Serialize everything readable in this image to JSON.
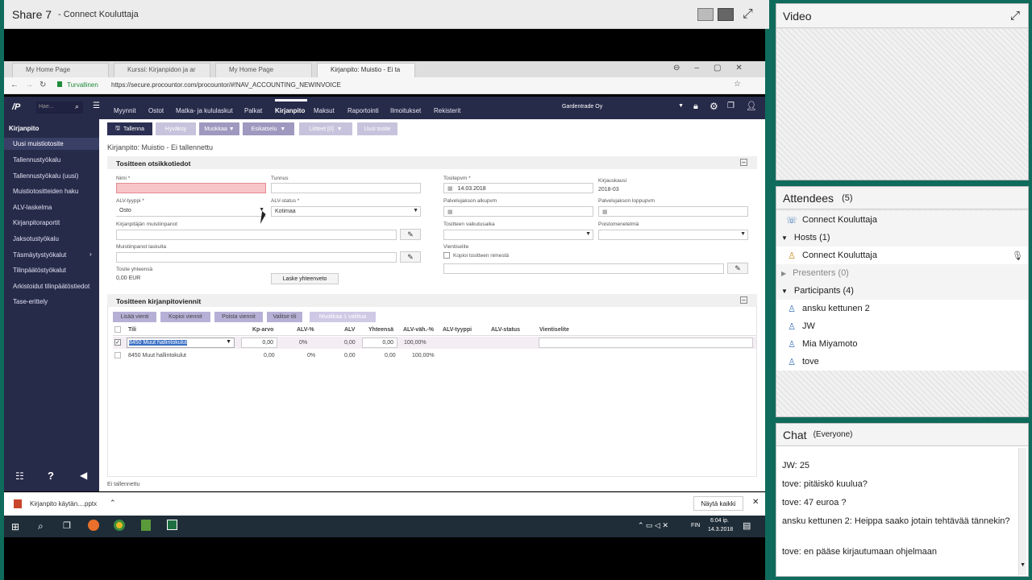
{
  "app": {
    "title": "Share 7",
    "subtitle": "- Connect Kouluttaja"
  },
  "browser": {
    "tabs": [
      "My Home Page",
      "Kurssi: Kirjanpidon ja ar",
      "My Home Page",
      "Kirjanpito: Muistio - Ei ta"
    ],
    "secure_label": "Turvallinen",
    "url": "https://secure.procountor.com/procountor/#!NAV_ACCOUNTING_NEWINVOICE"
  },
  "procountor": {
    "logo": "/P",
    "search_placeholder": "Hae...",
    "menu": [
      "Myynnit",
      "Ostot",
      "Matka- ja kululaskut",
      "Palkat",
      "Kirjanpito",
      "Maksut",
      "Raportointi",
      "Ilmoitukset",
      "Rekisterit"
    ],
    "company": "Gardentrade Oy",
    "sidebar_title": "Kirjanpito",
    "sidebar_items": [
      "Uusi muistiotosite",
      "Tallennustyökalu",
      "Tallennustyökalu (uusi)",
      "Muistiotositteiden haku",
      "ALV-laskelma",
      "Kirjanpitoraportit",
      "Jaksotustyökalu",
      "Täsmäytystyökalut",
      "Tilinpäätöstyökalut",
      "Arkistoidut tilinpäätöstiedot",
      "Tase-erittely"
    ],
    "toolbar": {
      "save": "Tallenna",
      "approve": "Hyväksy",
      "edit": "Muokkaa",
      "preview": "Esikatselu",
      "attachments": "Liitteet [0]",
      "new": "Uusi tosite"
    },
    "page_title": "Kirjanpito: Muistio - Ei tallennettu",
    "section1": "Tositteen otsikkotiedot",
    "fields": {
      "name": "Nimi *",
      "code": "Tunnus",
      "date_label": "Tositepvm *",
      "date": "14.03.2018",
      "period_label": "Kirjauskausi",
      "period": "2018-03",
      "vat_type_label": "ALV-tyyppi *",
      "vat_type": "Osto",
      "vat_status_label": "ALV-status *",
      "vat_status": "Kotimaa",
      "service_start": "Palvelujakson alkupvm",
      "service_end": "Palvelujakson loppupvm",
      "notes_label": "Kirjanpitäjän muistiinpanot",
      "effect_label": "Tositteen vaikutusaika",
      "depr_label": "Poistomenetelmä",
      "invoice_notes_label": "Muistiinpanot laskulta",
      "entry_label": "Vientiselite",
      "copy_label": "Kopioi tositteen nimestä",
      "total_label": "Tosite yhteensä",
      "total": "0,00 EUR",
      "calc": "Laske yhteenveto"
    },
    "section2": "Tositteen kirjanpitoviennit",
    "grid_buttons": [
      "Lisää vienti",
      "Kopioi viennit",
      "Poista viennit",
      "Valitse tili",
      "Muokkaa 1 valittua"
    ],
    "columns": [
      "Tili",
      "Kp-arvo",
      "ALV-%",
      "ALV",
      "Yhteensä",
      "ALV-väh.-%",
      "ALV-tyyppi",
      "ALV-status",
      "Vientiselite"
    ],
    "rows": [
      {
        "account": "8450 Muut hallintokulut",
        "kp": "0,00",
        "vatp": "0%",
        "vat": "0,00",
        "total": "0,00",
        "ded": "100,00%"
      },
      {
        "account": "8450 Muut hallintokulut",
        "kp": "0,00",
        "vatp": "0%",
        "vat": "0,00",
        "total": "0,00",
        "ded": "100,00%"
      }
    ],
    "status": "Ei tallennettu"
  },
  "download": {
    "file": "Kirjanpito käytän....pptx",
    "show_all": "Näytä kaikki"
  },
  "taskbar": {
    "lang": "FIN",
    "time": "6:04 ip.",
    "date": "14.3.2018"
  },
  "video": {
    "title": "Video"
  },
  "attendees": {
    "title": "Attendees",
    "count": "(5)",
    "host_self": "Connect Kouluttaja",
    "hosts_label": "Hosts (1)",
    "host": "Connect Kouluttaja",
    "presenters_label": "Presenters (0)",
    "participants_label": "Participants (4)",
    "participants": [
      "ansku kettunen 2",
      "JW",
      "Mia Miyamoto",
      "tove"
    ]
  },
  "chat": {
    "title": "Chat",
    "scope": "(Everyone)",
    "messages": [
      {
        "who": "JW:",
        "text": "25"
      },
      {
        "who": "tove:",
        "text": "pitäiskö kuulua?"
      },
      {
        "who": "tove:",
        "text": "47 euroa ?"
      },
      {
        "who": "ansku kettunen 2:",
        "text": "Heippa saako jotain tehtävää tännekin?"
      },
      {
        "who": "tove:",
        "text": "en pääse kirjautumaan ohjelmaan"
      }
    ]
  },
  "colors": {
    "accent_nav": "#272b4a",
    "button_purple": "#9f98bf",
    "background_teal": "#0f6b5c"
  }
}
